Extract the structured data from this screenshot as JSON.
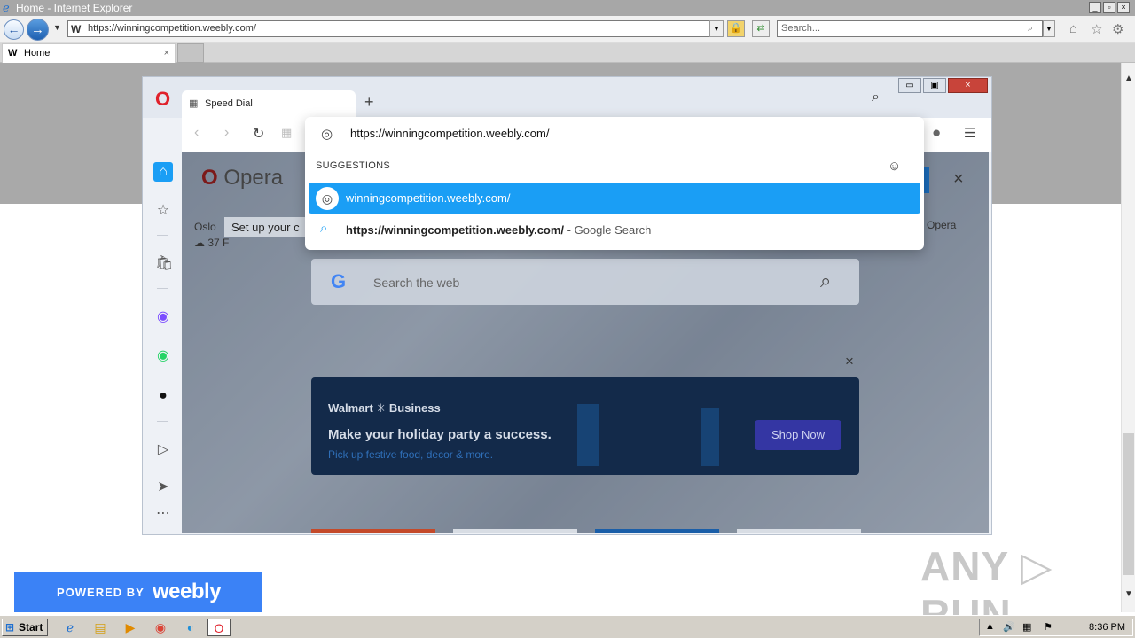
{
  "ie": {
    "title": "Home - Internet Explorer",
    "address": "https://winningcompetition.weebly.com/",
    "search_placeholder": "Search...",
    "tab_label": "Home",
    "tab_close": "×",
    "win_min": "_",
    "win_max": "▫",
    "win_close": "×"
  },
  "opera": {
    "tab_label": "Speed Dial",
    "new_tab": "+",
    "logo_text": "Opera",
    "weather_city": "Oslo",
    "weather_temp": "37 F",
    "setup_text": "Set up your c",
    "right_label": "Opera",
    "close_x": "×",
    "search_placeholder": "Search the web",
    "ad": {
      "brand": "Walmart ✳ Business",
      "headline": "Make your holiday party a success.",
      "sub": "Pick up festive food, decor & more.",
      "button": "Shop Now"
    },
    "dropdown": {
      "url": "https://winningcompetition.weebly.com/",
      "header": "SUGGESTIONS",
      "suggestion1": "winningcompetition.weebly.com/",
      "suggestion2_url": "https://winningcompetition.weebly.com/",
      "suggestion2_type": " - Google Search"
    }
  },
  "page": {
    "powered_by": "POWERED BY",
    "weebly": "weebly",
    "watermark": "ANY ▷ RUN"
  },
  "taskbar": {
    "start": "Start",
    "clock": "8:36 PM"
  }
}
